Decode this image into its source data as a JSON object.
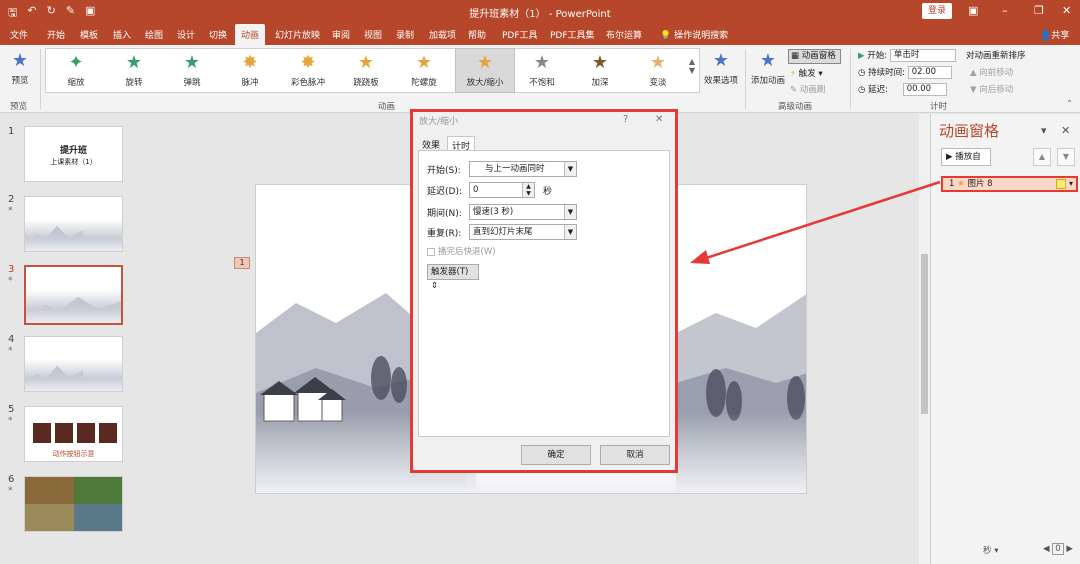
{
  "titlebar": {
    "doc_title": "提升班素材（1） - PowerPoint",
    "login": "登录",
    "qat_icons": [
      "save-icon",
      "undo-icon",
      "redo-icon",
      "format-painter-icon",
      "present-icon"
    ]
  },
  "tabs": [
    "文件",
    "开始",
    "模板",
    "插入",
    "绘图",
    "设计",
    "切换",
    "动画",
    "幻灯片放映",
    "审阅",
    "视图",
    "录制",
    "加载项",
    "帮助",
    "PDF工具",
    "PDF工具集",
    "布尔运算"
  ],
  "tellme": "操作说明搜索",
  "share": "共享",
  "ribbon": {
    "preview": "预览",
    "preview_group": "预览",
    "animations": [
      "缩放",
      "旋转",
      "弹跳",
      "脉冲",
      "彩色脉冲",
      "跷跷板",
      "陀螺旋",
      "放大/缩小",
      "不饱和",
      "加深",
      "变淡"
    ],
    "effect_options": "效果选项",
    "animation_group": "动画",
    "add_animation": "添加动画",
    "animation_pane": "动画窗格",
    "trigger": "触发",
    "animation_painter": "动画刷",
    "advanced_group": "高级动画",
    "start_label": "开始:",
    "start_value": "单击时",
    "duration_label": "持续时间:",
    "duration_value": "02.00",
    "delay_label": "延迟:",
    "delay_value": "00.00",
    "reorder": "对动画重新排序",
    "move_earlier": "向前移动",
    "move_later": "向后移动",
    "timing_group": "计时"
  },
  "thumbnails": {
    "items": [
      {
        "num": "1",
        "title": "提升班",
        "subtitle": "上课素材（1）"
      },
      {
        "num": "2",
        "star": "*"
      },
      {
        "num": "3",
        "star": "*"
      },
      {
        "num": "4",
        "star": "*"
      },
      {
        "num": "5",
        "star": "*",
        "caption": "动作按钮示意"
      },
      {
        "num": "6",
        "star": "*"
      }
    ]
  },
  "slide": {
    "tag": "1"
  },
  "anim_pane": {
    "title": "动画窗格",
    "play": "播放自",
    "item_num": "1",
    "item_label": "图片 8",
    "seconds": "秒",
    "zoom": "0"
  },
  "dialog": {
    "title": "放大/缩小",
    "help": "?",
    "tab_effect": "效果",
    "tab_timing": "计时",
    "start_label": "开始(S):",
    "start_value": "与上一动画同时",
    "delay_label": "延迟(D):",
    "delay_value": "0",
    "delay_unit": "秒",
    "duration_label": "期间(N):",
    "duration_value": "慢速(3 秒)",
    "repeat_label": "重复(R):",
    "repeat_value": "直到幻灯片末尾",
    "rewind": "播完后快退(W)",
    "trigger": "触发器(T)",
    "ok": "确定",
    "cancel": "取消"
  },
  "colors": {
    "accent": "#b7472a",
    "highlight_border": "#e53935",
    "anim_item_bg": "#fbd7c7"
  }
}
